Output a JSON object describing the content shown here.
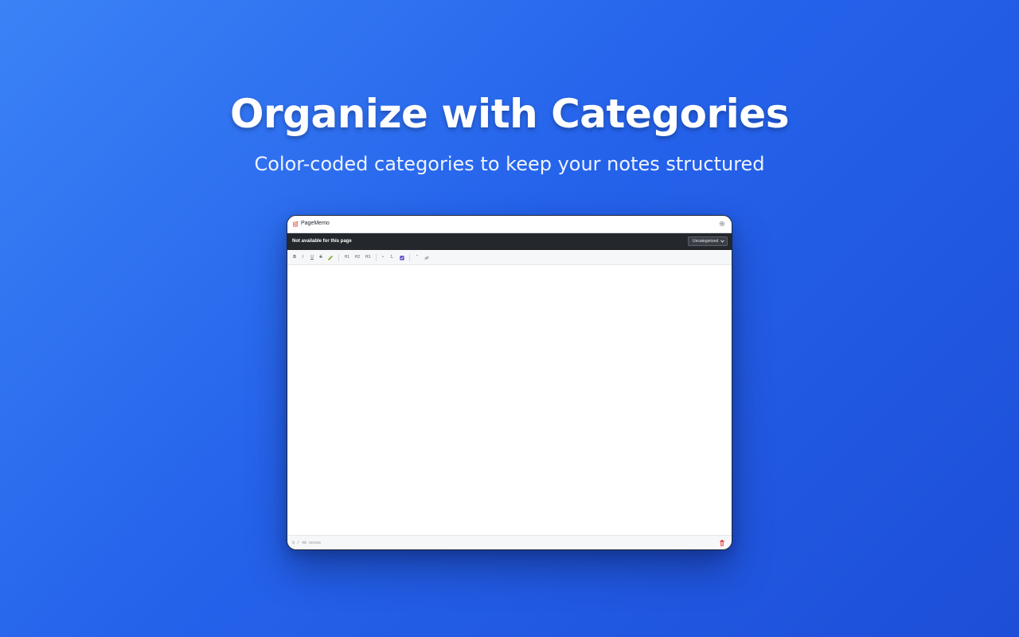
{
  "hero": {
    "headline": "Organize with Categories",
    "subheadline": "Color-coded categories to keep your notes structured"
  },
  "app": {
    "name": "PageMemo",
    "icon": "memo-icon",
    "settings_icon": "gear-icon"
  },
  "page_bar": {
    "status": "Not available for this page",
    "category_select": {
      "value": "Uncategorized",
      "icon": "chevron-down-icon"
    }
  },
  "toolbar": {
    "bold": "B",
    "italic": "I",
    "underline": "U",
    "strikethrough": "S",
    "highlight_icon": "highlighter-icon",
    "h1": "H1",
    "h2": "H2",
    "h3": "H3",
    "bullet_list": "•",
    "numbered_list": "1.",
    "checkbox_icon": "checkbox-icon",
    "quote": "\"",
    "link_icon": "link-icon"
  },
  "status_bar": {
    "counter": "0 / 40 notes",
    "delete_icon": "trash-icon"
  },
  "colors": {
    "background_start": "#3b82f6",
    "background_end": "#1d4ed8",
    "page_bar": "#24272c",
    "highlight": "#65a30d",
    "checkbox": "#5b4bc4",
    "delete": "#dc2626"
  }
}
